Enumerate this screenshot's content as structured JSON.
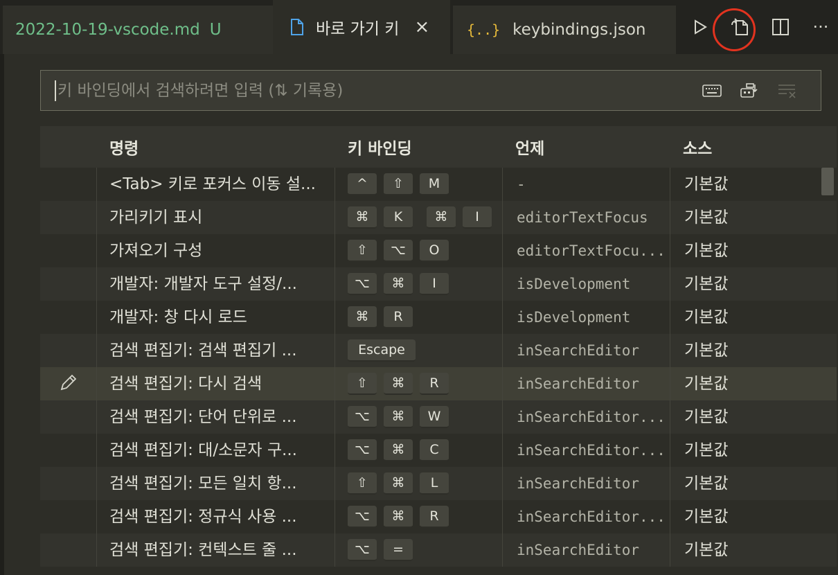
{
  "tabs": [
    {
      "label": "2022-10-19-vscode.md",
      "badge": "U"
    },
    {
      "label": "바로 가기 키",
      "close": "×"
    },
    {
      "label": "keybindings.json",
      "icon_text": "{..}"
    }
  ],
  "actions": {
    "run": "▷",
    "open_json": "open-keybindings-json",
    "split": "split-editor",
    "more": "···"
  },
  "search": {
    "placeholder": "키 바인딩에서 검색하려면 입력 (⇅ 기록용)",
    "value": ""
  },
  "table": {
    "headers": {
      "command": "명령",
      "keybinding": "키 바인딩",
      "when": "언제",
      "source": "소스"
    },
    "rows": [
      {
        "command": "<Tab> 키로 포커스 이동 설...",
        "keys": [
          [
            "^",
            "⇧",
            "M"
          ]
        ],
        "when": "-",
        "source": "기본값"
      },
      {
        "command": "가리키기 표시",
        "keys": [
          [
            "⌘",
            "K"
          ],
          [
            "⌘",
            "I"
          ]
        ],
        "when": "editorTextFocus",
        "source": "기본값"
      },
      {
        "command": "가져오기 구성",
        "keys": [
          [
            "⇧",
            "⌥",
            "O"
          ]
        ],
        "when": "editorTextFocu...",
        "source": "기본값"
      },
      {
        "command": "개발자: 개발자 도구 설정/...",
        "keys": [
          [
            "⌥",
            "⌘",
            "I"
          ]
        ],
        "when": "isDevelopment",
        "source": "기본값"
      },
      {
        "command": "개발자: 창 다시 로드",
        "keys": [
          [
            "⌘",
            "R"
          ]
        ],
        "when": "isDevelopment",
        "source": "기본값"
      },
      {
        "command": "검색 편집기: 검색 편집기 ...",
        "keys": [
          [
            "Escape"
          ]
        ],
        "when": "inSearchEditor",
        "source": "기본값"
      },
      {
        "command": "검색 편집기: 다시 검색",
        "keys": [
          [
            "⇧",
            "⌘",
            "R"
          ]
        ],
        "when": "inSearchEditor",
        "source": "기본값",
        "selected": true
      },
      {
        "command": "검색 편집기: 단어 단위로 ...",
        "keys": [
          [
            "⌥",
            "⌘",
            "W"
          ]
        ],
        "when": "inSearchEditor...",
        "source": "기본값"
      },
      {
        "command": "검색 편집기: 대/소문자 구...",
        "keys": [
          [
            "⌥",
            "⌘",
            "C"
          ]
        ],
        "when": "inSearchEditor...",
        "source": "기본값"
      },
      {
        "command": "검색 편집기: 모든 일치 항...",
        "keys": [
          [
            "⇧",
            "⌘",
            "L"
          ]
        ],
        "when": "inSearchEditor",
        "source": "기본값"
      },
      {
        "command": "검색 편집기: 정규식 사용 ...",
        "keys": [
          [
            "⌥",
            "⌘",
            "R"
          ]
        ],
        "when": "inSearchEditor...",
        "source": "기본값"
      },
      {
        "command": "검색 편집기: 컨텍스트 줄 ...",
        "keys": [
          [
            "⌥",
            "="
          ]
        ],
        "when": "inSearchEditor",
        "source": "기본값"
      }
    ]
  },
  "colors": {
    "accent_ring": "#e2331f",
    "md_tab": "#6fbf8a",
    "json_icon": "#e5b93a"
  }
}
